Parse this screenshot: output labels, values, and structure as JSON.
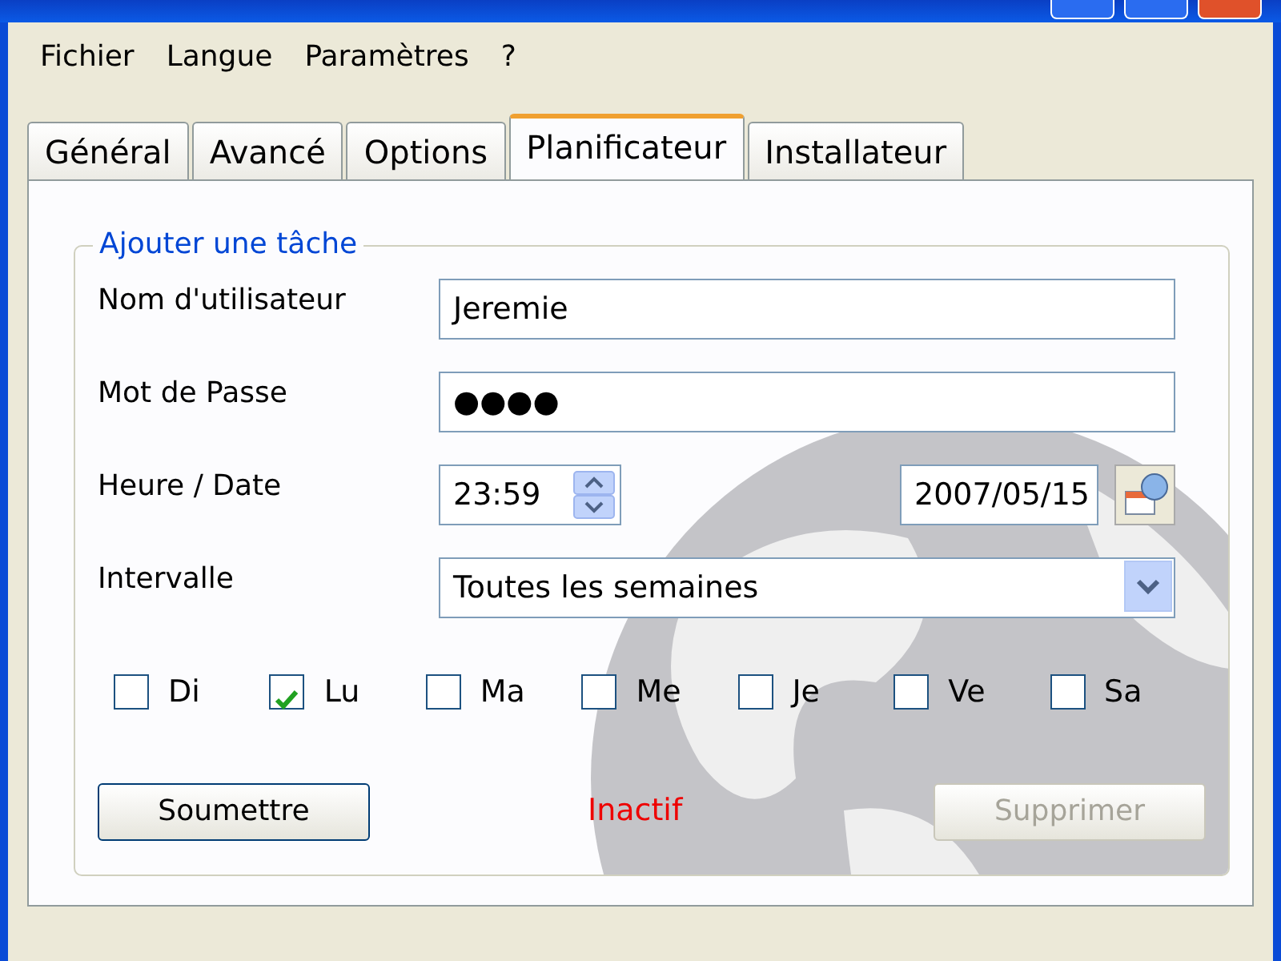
{
  "menu": [
    "Fichier",
    "Langue",
    "Paramètres",
    "?"
  ],
  "tabs": [
    {
      "label": "Général",
      "selected": false
    },
    {
      "label": "Avancé",
      "selected": false
    },
    {
      "label": "Options",
      "selected": false
    },
    {
      "label": "Planificateur",
      "selected": true
    },
    {
      "label": "Installateur",
      "selected": false
    }
  ],
  "group": {
    "title": "Ajouter une tâche",
    "username": {
      "label": "Nom d'utilisateur",
      "value": "Jeremie"
    },
    "password": {
      "label": "Mot de Passe",
      "value": "●●●●"
    },
    "time_date": {
      "label": "Heure / Date",
      "time": "23:59",
      "date": "2007/05/15"
    },
    "interval": {
      "label": "Intervalle",
      "value": "Toutes les semaines"
    },
    "days": [
      {
        "label": "Di",
        "checked": false
      },
      {
        "label": "Lu",
        "checked": true
      },
      {
        "label": "Ma",
        "checked": false
      },
      {
        "label": "Me",
        "checked": false
      },
      {
        "label": "Je",
        "checked": false
      },
      {
        "label": "Ve",
        "checked": false
      },
      {
        "label": "Sa",
        "checked": false
      }
    ],
    "submit_button": "Soumettre",
    "status": "Inactif",
    "delete_button": {
      "label": "Supprimer",
      "disabled": true
    }
  }
}
